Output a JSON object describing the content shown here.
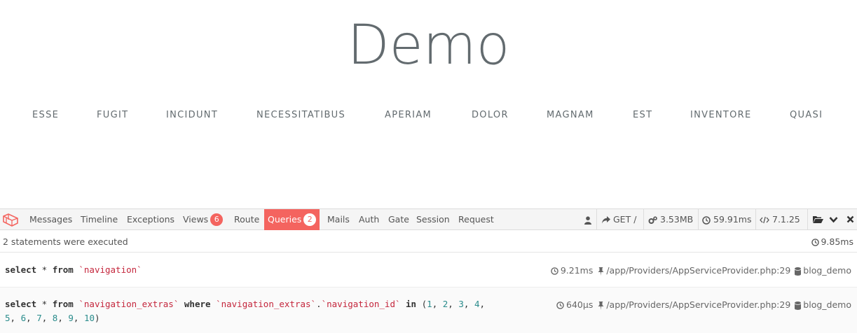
{
  "page": {
    "title": "Demo",
    "nav": [
      "ESSE",
      "FUGIT",
      "INCIDUNT",
      "NECESSITATIBUS",
      "APERIAM",
      "DOLOR",
      "MAGNAM",
      "EST",
      "INVENTORE",
      "QUASI"
    ]
  },
  "debugbar": {
    "tabs": {
      "messages": "Messages",
      "timeline": "Timeline",
      "exceptions": "Exceptions",
      "views": "Views",
      "views_count": "6",
      "route": "Route",
      "queries": "Queries",
      "queries_count": "2",
      "mails": "Mails",
      "auth": "Auth",
      "gate": "Gate",
      "session": "Session",
      "request": "Request"
    },
    "right": {
      "user_icon": "user-icon",
      "request": "GET /",
      "memory": "3.53MB",
      "time": "59.91ms",
      "php_version": "7.1.25"
    },
    "status": {
      "statement_count": "2 statements were executed",
      "total_duration": "9.85ms"
    },
    "statements": [
      {
        "duration": "9.21ms",
        "source": "/app/Providers/AppServiceProvider.php:29",
        "connection": "blog_demo"
      },
      {
        "duration": "640μs",
        "source": "/app/Providers/AppServiceProvider.php:29",
        "connection": "blog_demo"
      }
    ],
    "sql": {
      "s1_select": "select",
      "s1_star": " * ",
      "s1_from": "from",
      "s1_table": "`navigation`",
      "s2_select": "select",
      "s2_star": " * ",
      "s2_from": "from",
      "s2_table": "`navigation_extras`",
      "s2_where": "where",
      "s2_col_table": "`navigation_extras`",
      "s2_dot": ".",
      "s2_col": "`navigation_id`",
      "s2_in": "in",
      "s2_ids": [
        "1",
        "2",
        "3",
        "4",
        "5",
        "6",
        "7",
        "8",
        "9",
        "10"
      ]
    },
    "colors": {
      "accent": "#f4645f",
      "sql_string": "#c4263c",
      "sql_number": "#2a8c8c"
    }
  }
}
